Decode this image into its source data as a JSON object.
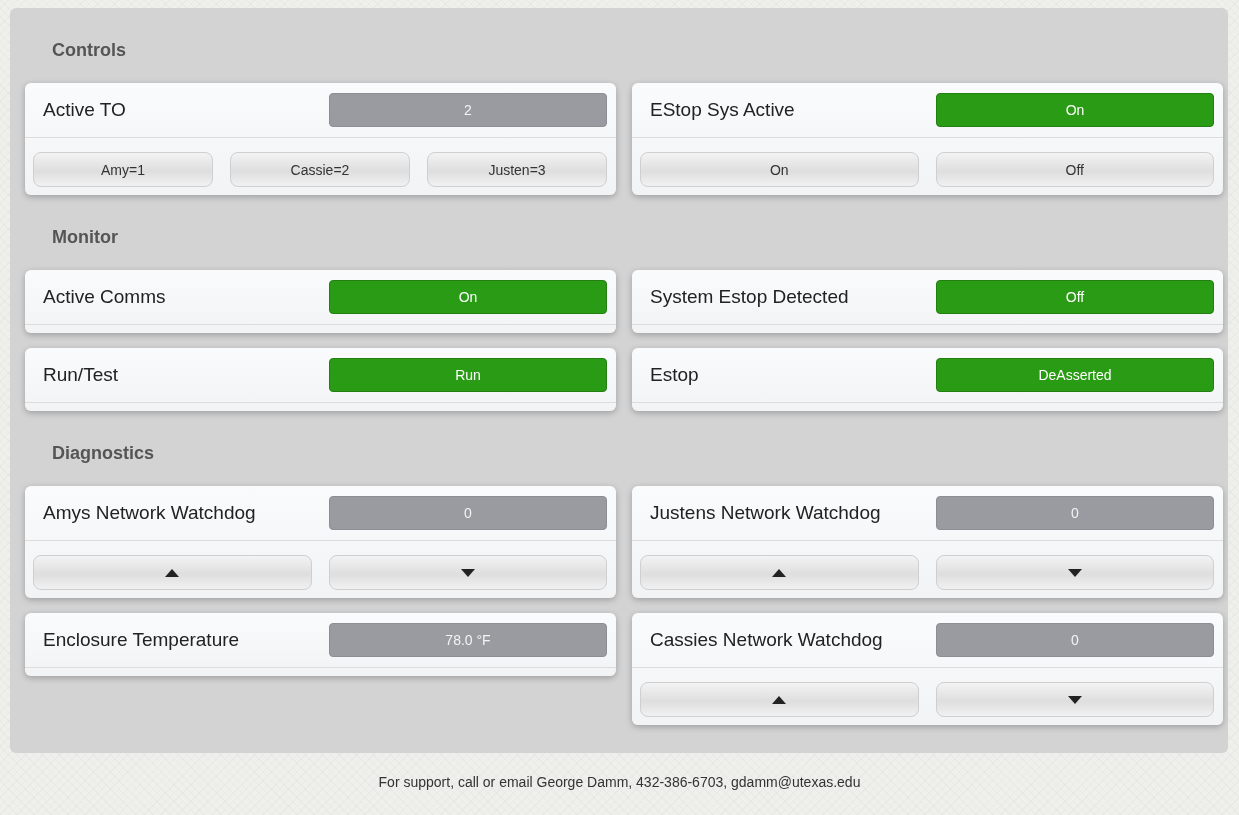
{
  "sections": [
    {
      "title": "Controls",
      "columns": [
        [
          {
            "label": "Active TO",
            "indicator": {
              "kind": "value",
              "text": "2"
            },
            "buttons": [
              {
                "kind": "text",
                "label": "Amy=1"
              },
              {
                "kind": "text",
                "label": "Cassie=2"
              },
              {
                "kind": "text",
                "label": "Justen=3"
              }
            ]
          }
        ],
        [
          {
            "label": "EStop Sys Active",
            "indicator": {
              "kind": "status",
              "text": "On"
            },
            "buttons": [
              {
                "kind": "text",
                "label": "On"
              },
              {
                "kind": "text",
                "label": "Off"
              }
            ]
          }
        ]
      ]
    },
    {
      "title": "Monitor",
      "columns": [
        [
          {
            "label": "Active Comms",
            "indicator": {
              "kind": "status",
              "text": "On"
            }
          },
          {
            "label": "Run/Test",
            "indicator": {
              "kind": "status",
              "text": "Run"
            }
          }
        ],
        [
          {
            "label": "System Estop Detected",
            "indicator": {
              "kind": "status",
              "text": "Off"
            }
          },
          {
            "label": "Estop",
            "indicator": {
              "kind": "status",
              "text": "DeAsserted"
            }
          }
        ]
      ]
    },
    {
      "title": "Diagnostics",
      "columns": [
        [
          {
            "label": "Amys Network Watchdog",
            "indicator": {
              "kind": "value",
              "text": "0"
            },
            "buttons": [
              {
                "kind": "up"
              },
              {
                "kind": "down"
              }
            ]
          },
          {
            "label": "Enclosure Temperature",
            "indicator": {
              "kind": "value",
              "text": "78.0 °F"
            }
          }
        ],
        [
          {
            "label": "Justens Network Watchdog",
            "indicator": {
              "kind": "value",
              "text": "0"
            },
            "buttons": [
              {
                "kind": "up"
              },
              {
                "kind": "down"
              }
            ]
          },
          {
            "label": "Cassies Network Watchdog",
            "indicator": {
              "kind": "value",
              "text": "0"
            },
            "buttons": [
              {
                "kind": "up"
              },
              {
                "kind": "down"
              }
            ]
          }
        ]
      ]
    }
  ],
  "footer": "For support, call or email George Damm, 432-386-6703, gdamm@utexas.edu"
}
